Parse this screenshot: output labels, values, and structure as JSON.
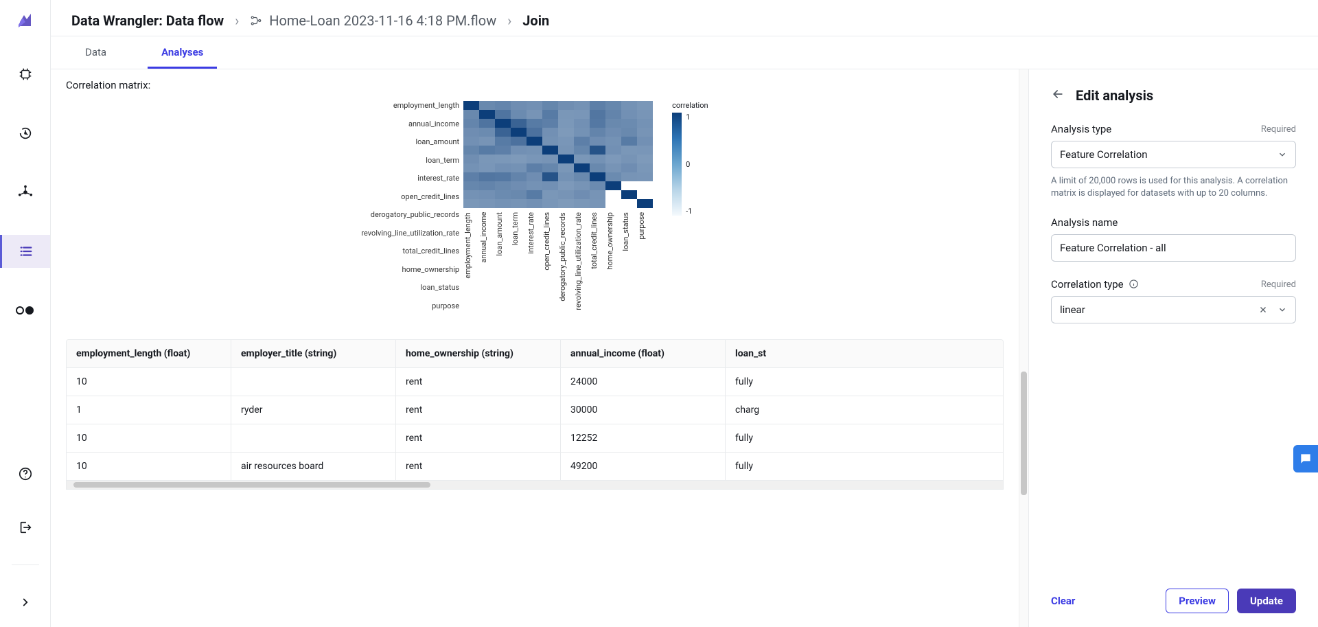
{
  "breadcrumb": {
    "root": "Data Wrangler: Data flow",
    "flow_name": "Home-Loan 2023-11-16 4:18 PM.flow",
    "step": "Join"
  },
  "tabs": {
    "data": "Data",
    "analyses": "Analyses"
  },
  "viz": {
    "title": "Correlation matrix:"
  },
  "chart_data": {
    "type": "heatmap",
    "title": "",
    "legend_title": "correlation",
    "axis_labels": [
      "employment_length",
      "annual_income",
      "loan_amount",
      "loan_term",
      "interest_rate",
      "open_credit_lines",
      "derogatory_public_records",
      "revolving_line_utilization_rate",
      "total_credit_lines",
      "home_ownership",
      "loan_status",
      "purpose"
    ],
    "color_scale_ticks": [
      "1",
      "0",
      "-1"
    ],
    "matrix": [
      [
        1.0,
        0.2,
        0.24,
        0.15,
        0.12,
        0.23,
        0.14,
        0.1,
        0.3,
        0.22,
        0.1,
        0.05
      ],
      [
        0.2,
        1.0,
        0.42,
        0.18,
        0.08,
        0.35,
        0.05,
        0.06,
        0.4,
        0.25,
        0.12,
        0.07
      ],
      [
        0.24,
        0.42,
        1.0,
        0.6,
        0.35,
        0.3,
        0.04,
        0.12,
        0.38,
        0.2,
        0.18,
        0.1
      ],
      [
        0.15,
        0.18,
        0.6,
        1.0,
        0.45,
        0.12,
        0.02,
        0.1,
        0.25,
        0.15,
        0.2,
        0.08
      ],
      [
        0.12,
        0.08,
        0.35,
        0.45,
        1.0,
        0.1,
        0.06,
        0.3,
        0.15,
        0.1,
        0.35,
        0.12
      ],
      [
        0.23,
        0.35,
        0.3,
        0.12,
        0.1,
        1.0,
        0.08,
        0.22,
        0.78,
        0.12,
        0.05,
        0.06
      ],
      [
        0.14,
        0.05,
        0.04,
        0.02,
        0.06,
        0.08,
        1.0,
        0.05,
        0.1,
        0.03,
        0.08,
        0.02
      ],
      [
        0.1,
        0.06,
        0.12,
        0.1,
        0.3,
        0.22,
        0.05,
        1.0,
        0.2,
        0.08,
        0.15,
        0.05
      ],
      [
        0.3,
        0.4,
        0.38,
        0.25,
        0.15,
        0.78,
        0.1,
        0.2,
        1.0,
        0.18,
        0.08,
        0.07
      ],
      [
        0.22,
        0.25,
        0.2,
        0.15,
        0.1,
        0.12,
        0.03,
        0.08,
        0.18,
        1.0,
        null,
        null
      ],
      [
        0.1,
        0.12,
        0.18,
        0.2,
        0.35,
        0.05,
        0.08,
        0.15,
        0.08,
        null,
        1.0,
        null
      ],
      [
        0.05,
        0.07,
        0.1,
        0.08,
        0.12,
        0.06,
        0.02,
        0.05,
        0.07,
        null,
        null,
        1.0
      ]
    ]
  },
  "table": {
    "headers": [
      "employment_length (float)",
      "employer_title (string)",
      "home_ownership (string)",
      "annual_income (float)",
      "loan_st"
    ],
    "rows": [
      [
        "10",
        "",
        "rent",
        "24000",
        "fully"
      ],
      [
        "1",
        "ryder",
        "rent",
        "30000",
        "charg"
      ],
      [
        "10",
        "",
        "rent",
        "12252",
        "fully"
      ],
      [
        "10",
        "air resources board",
        "rent",
        "49200",
        "fully"
      ]
    ]
  },
  "form": {
    "title": "Edit analysis",
    "analysis_type_label": "Analysis type",
    "required": "Required",
    "analysis_type_value": "Feature Correlation",
    "analysis_type_helper": "A limit of 20,000 rows is used for this analysis. A correlation matrix is displayed for datasets with up to 20 columns.",
    "analysis_name_label": "Analysis name",
    "analysis_name_value": "Feature Correlation - all",
    "corr_type_label": "Correlation type",
    "corr_type_value": "linear",
    "clear": "Clear",
    "preview": "Preview",
    "update": "Update"
  }
}
